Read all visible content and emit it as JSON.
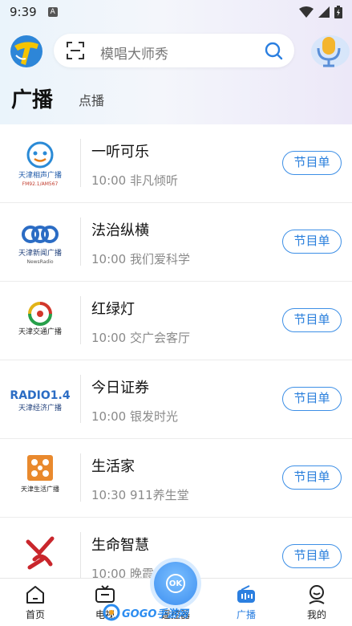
{
  "status_bar": {
    "time": "9:39",
    "notif_letter": "A"
  },
  "header": {
    "search_placeholder": "模唱大师秀"
  },
  "tabs": {
    "active": "广播",
    "inactive": "点播"
  },
  "stations": [
    {
      "name": "一听可乐",
      "time": "10:00",
      "program": "非凡倾听",
      "button": "节目单",
      "logo_text": "天津相声广播",
      "logo_sub": "FM92.1/AM567"
    },
    {
      "name": "法治纵横",
      "time": "10:00",
      "program": "我们爱科学",
      "button": "节目单",
      "logo_text": "天津新闻广播",
      "logo_sub": "NewsRadio"
    },
    {
      "name": "红绿灯",
      "time": "10:00",
      "program": "交广会客厅",
      "button": "节目单",
      "logo_text": "天津交通广播",
      "logo_sub": ""
    },
    {
      "name": "今日证券",
      "time": "10:00",
      "program": "银发时光",
      "button": "节目单",
      "logo_text": "天津经济广播",
      "logo_sub": "RADIO1.4"
    },
    {
      "name": "生活家",
      "time": "10:30",
      "program": "911养生堂",
      "button": "节目单",
      "logo_text": "天津生活广播",
      "logo_sub": ""
    },
    {
      "name": "生命智慧",
      "time": "10:00",
      "program": "晚霞",
      "button": "节目单",
      "logo_text": "",
      "logo_sub": ""
    }
  ],
  "bottom_nav": [
    {
      "label": "首页",
      "icon": "home-icon"
    },
    {
      "label": "电视",
      "icon": "tv-icon"
    },
    {
      "label": "遥控器",
      "icon": "remote-icon"
    },
    {
      "label": "广播",
      "icon": "radio-icon"
    },
    {
      "label": "我的",
      "icon": "profile-icon"
    }
  ],
  "ok_label": "OK",
  "watermark": {
    "brand": "GOGO手游网"
  },
  "colors": {
    "accent": "#2b7fe0",
    "button_border": "#3d8fe6"
  }
}
